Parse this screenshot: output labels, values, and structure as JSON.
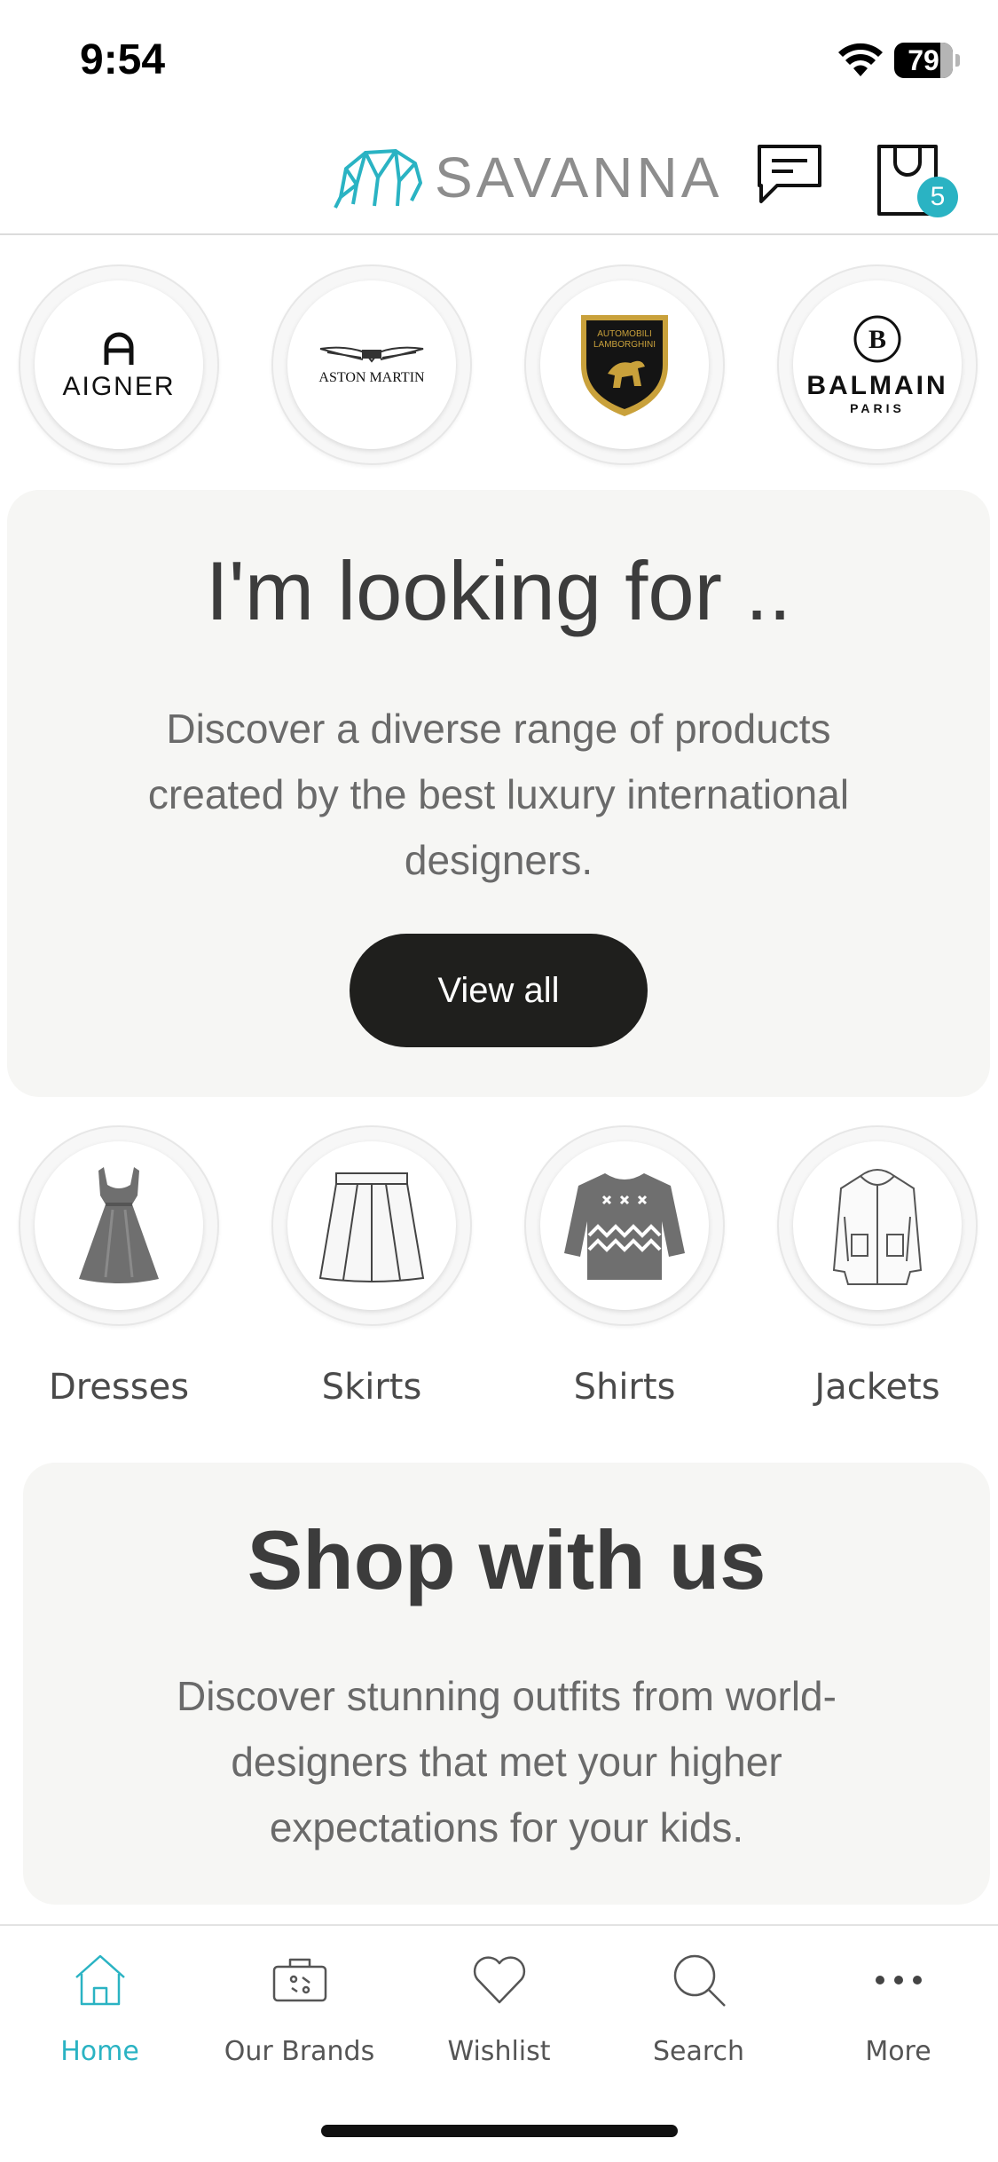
{
  "status_bar": {
    "time": "9:54",
    "battery_level": 79,
    "battery_text": "79"
  },
  "header": {
    "logo_text": "SAVANNA",
    "cart_count": "5",
    "accent_color": "#2ab3c3"
  },
  "brands": [
    {
      "name": "AIGNER",
      "logo": "aigner-logo"
    },
    {
      "name": "ASTON MARTIN",
      "logo": "aston-martin-wings-logo"
    },
    {
      "name": "AUTOMOBILI LAMBORGHINI",
      "logo": "lamborghini-bull-shield-logo"
    },
    {
      "name": "BALMAIN",
      "subname": "PARIS",
      "logo": "balmain-b-logo"
    }
  ],
  "hero": {
    "title": "I'm looking for ..",
    "text": "Discover a diverse range of products created by the best luxury international designers.",
    "button_label": "View all"
  },
  "categories": [
    {
      "label": "Dresses",
      "icon": "dress-icon"
    },
    {
      "label": "Skirts",
      "icon": "skirt-icon"
    },
    {
      "label": "Shirts",
      "icon": "sweater-icon"
    },
    {
      "label": "Jackets",
      "icon": "jacket-icon"
    }
  ],
  "shop": {
    "title": "Shop with us",
    "text": "Discover stunning outfits from world-designers that met your higher expectations for your kids."
  },
  "tab_bar": {
    "items": [
      {
        "label": "Home",
        "icon": "home-icon",
        "active": true
      },
      {
        "label": "Our Brands",
        "icon": "brands-case-icon",
        "active": false
      },
      {
        "label": "Wishlist",
        "icon": "heart-icon",
        "active": false
      },
      {
        "label": "Search",
        "icon": "search-icon",
        "active": false
      },
      {
        "label": "More",
        "icon": "more-dots-icon",
        "active": false
      }
    ]
  }
}
